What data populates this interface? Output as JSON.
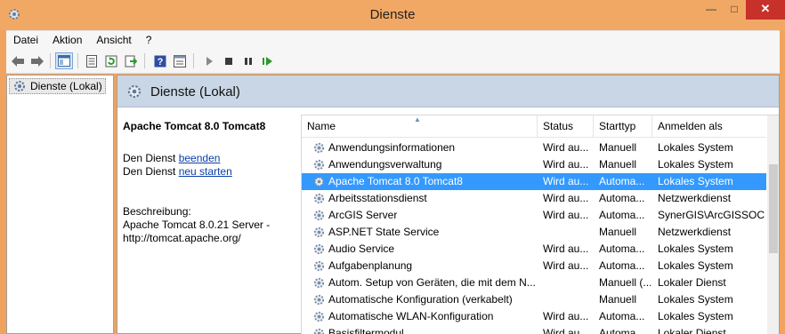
{
  "window": {
    "title": "Dienste",
    "close_glyph": "✕",
    "min_glyph": "—",
    "max_glyph": "□"
  },
  "menu": [
    "Datei",
    "Aktion",
    "Ansicht",
    "?"
  ],
  "tree": {
    "item": "Dienste (Lokal)"
  },
  "header": {
    "title": "Dienste (Lokal)"
  },
  "details": {
    "service_name": "Apache Tomcat 8.0 Tomcat8",
    "stop_prefix": "Den Dienst ",
    "stop_link": "beenden",
    "restart_prefix": "Den Dienst ",
    "restart_link": "neu starten",
    "desc_label": "Beschreibung:",
    "desc_line1": "Apache Tomcat 8.0.21 Server -",
    "desc_line2": "http://tomcat.apache.org/"
  },
  "columns": {
    "name": "Name",
    "status": "Status",
    "starttype": "Starttyp",
    "logon": "Anmelden als"
  },
  "rows": [
    {
      "name": "Anwendungsinformationen",
      "status": "Wird au...",
      "starttype": "Manuell",
      "logon": "Lokales System"
    },
    {
      "name": "Anwendungsverwaltung",
      "status": "Wird au...",
      "starttype": "Manuell",
      "logon": "Lokales System"
    },
    {
      "name": "Apache Tomcat 8.0 Tomcat8",
      "status": "Wird au...",
      "starttype": "Automa...",
      "logon": "Lokales System"
    },
    {
      "name": "Arbeitsstationsdienst",
      "status": "Wird au...",
      "starttype": "Automa...",
      "logon": "Netzwerkdienst"
    },
    {
      "name": "ArcGIS Server",
      "status": "Wird au...",
      "starttype": "Automa...",
      "logon": "SynerGIS\\ArcGISSOC"
    },
    {
      "name": "ASP.NET State Service",
      "status": "",
      "starttype": "Manuell",
      "logon": "Netzwerkdienst"
    },
    {
      "name": "Audio Service",
      "status": "Wird au...",
      "starttype": "Automa...",
      "logon": "Lokales System"
    },
    {
      "name": "Aufgabenplanung",
      "status": "Wird au...",
      "starttype": "Automa...",
      "logon": "Lokales System"
    },
    {
      "name": "Autom. Setup von Geräten, die mit dem N...",
      "status": "",
      "starttype": "Manuell (...",
      "logon": "Lokaler Dienst"
    },
    {
      "name": "Automatische Konfiguration (verkabelt)",
      "status": "",
      "starttype": "Manuell",
      "logon": "Lokales System"
    },
    {
      "name": "Automatische WLAN-Konfiguration",
      "status": "Wird au...",
      "starttype": "Automa...",
      "logon": "Lokales System"
    },
    {
      "name": "Basisfiltermodul",
      "status": "Wird au...",
      "starttype": "Automa...",
      "logon": "Lokaler Dienst"
    }
  ],
  "selected_row_index": 2,
  "colors": {
    "titlebar": "#f2a865",
    "close": "#c7312a",
    "selection": "#3399ff",
    "header_band": "#c9d6e5",
    "link": "#0a3fa8"
  },
  "icons": [
    "gear-icon",
    "back-arrow-icon",
    "forward-arrow-icon",
    "show-hide-tree-icon",
    "properties-icon",
    "refresh-icon",
    "export-icon",
    "help-icon",
    "details-view-icon",
    "play-icon",
    "stop-icon",
    "pause-icon",
    "resume-icon"
  ]
}
